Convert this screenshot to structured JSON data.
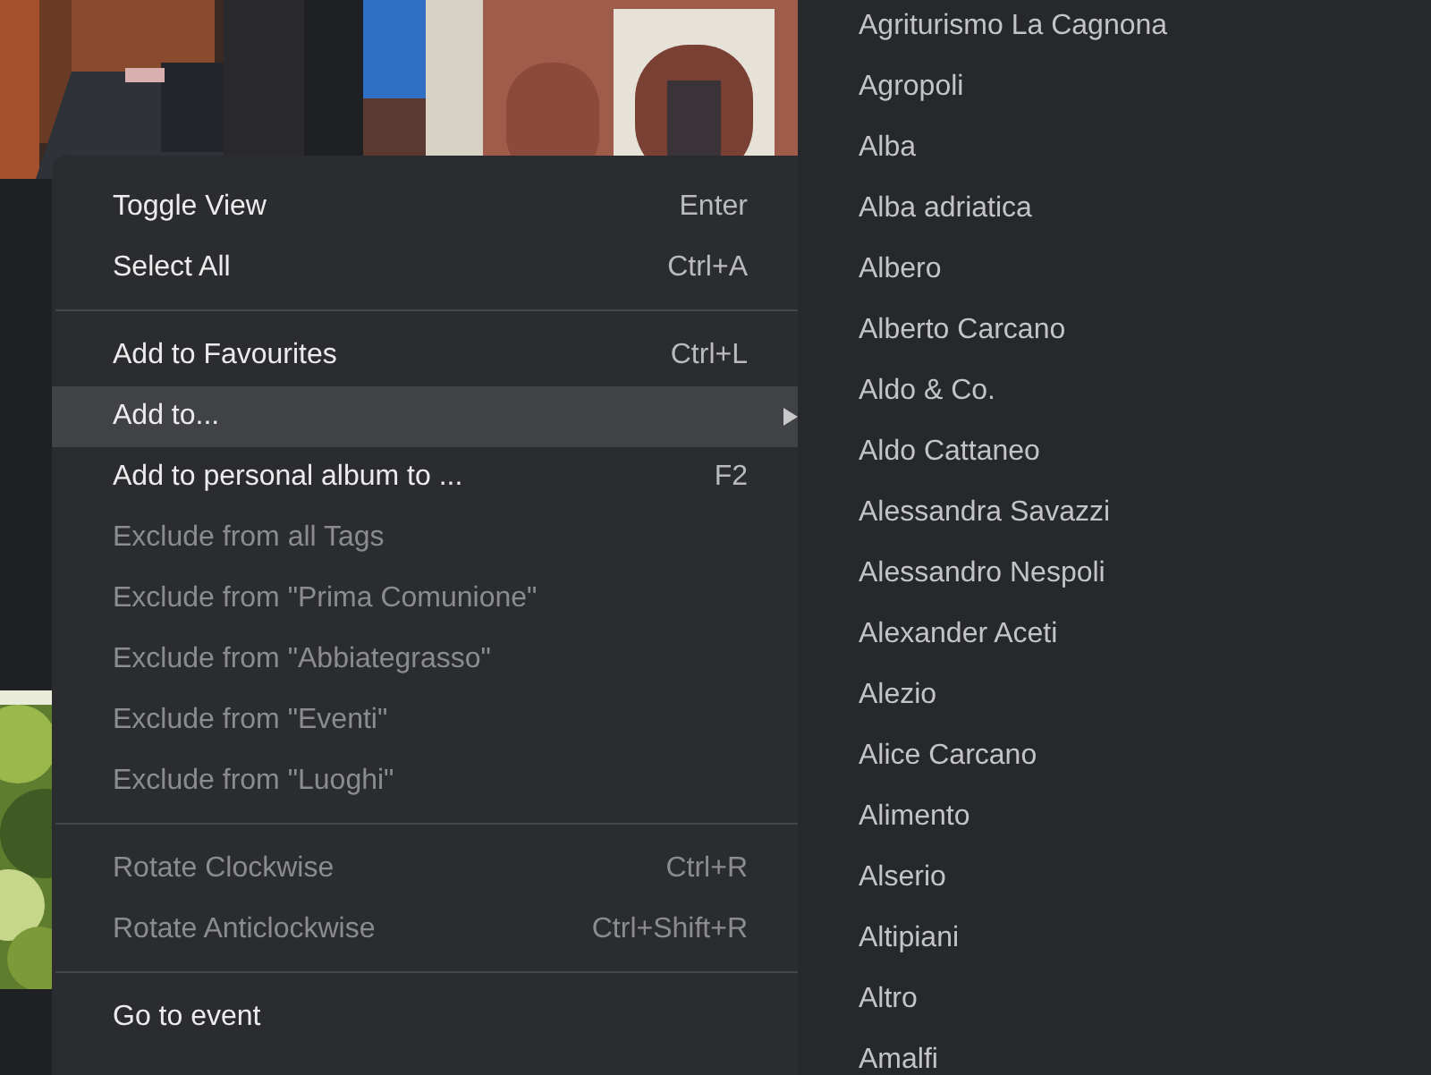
{
  "context_menu": {
    "items": [
      {
        "kind": "item",
        "label": "Toggle View",
        "shortcut": "Enter",
        "disabled": false,
        "selected": false
      },
      {
        "kind": "item",
        "label": "Select All",
        "shortcut": "Ctrl+A",
        "disabled": false,
        "selected": false
      },
      {
        "kind": "separator"
      },
      {
        "kind": "item",
        "label": "Add to Favourites",
        "shortcut": "Ctrl+L",
        "disabled": false,
        "selected": false
      },
      {
        "kind": "submenu",
        "label": "Add to...",
        "disabled": false,
        "selected": true
      },
      {
        "kind": "item",
        "label": "Add to personal album to ...",
        "shortcut": "F2",
        "disabled": false,
        "selected": false
      },
      {
        "kind": "item",
        "label": "Exclude from all Tags",
        "disabled": true,
        "selected": false
      },
      {
        "kind": "item",
        "label": "Exclude from \"Prima Comunione\"",
        "disabled": true,
        "selected": false
      },
      {
        "kind": "item",
        "label": "Exclude from \"Abbiategrasso\"",
        "disabled": true,
        "selected": false
      },
      {
        "kind": "item",
        "label": "Exclude from \"Eventi\"",
        "disabled": true,
        "selected": false
      },
      {
        "kind": "item",
        "label": "Exclude from \"Luoghi\"",
        "disabled": true,
        "selected": false
      },
      {
        "kind": "separator"
      },
      {
        "kind": "item",
        "label": "Rotate Clockwise",
        "shortcut": "Ctrl+R",
        "disabled": true,
        "selected": false
      },
      {
        "kind": "item",
        "label": "Rotate Anticlockwise",
        "shortcut": "Ctrl+Shift+R",
        "disabled": true,
        "selected": false
      },
      {
        "kind": "separator"
      },
      {
        "kind": "item",
        "label": "Go to event",
        "disabled": false,
        "selected": false
      }
    ]
  },
  "submenu": {
    "items": [
      "Agriturismo La Cagnona",
      "Agropoli",
      "Alba",
      "Alba adriatica",
      "Albero",
      "Alberto Carcano",
      "Aldo & Co.",
      "Aldo Cattaneo",
      "Alessandra Savazzi",
      "Alessandro Nespoli",
      "Alexander Aceti",
      "Alezio",
      "Alice Carcano",
      "Alimento",
      "Alserio",
      "Altipiani",
      "Altro",
      "Amalfi"
    ]
  }
}
